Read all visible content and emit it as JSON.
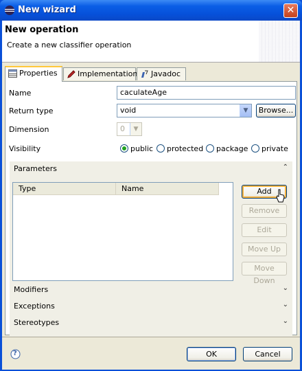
{
  "window": {
    "title": "New wizard"
  },
  "header": {
    "title": "New operation",
    "description": "Create a new classifier operation"
  },
  "tabs": [
    {
      "label": "Properties",
      "icon": "table-icon",
      "active": true
    },
    {
      "label": "Implementation",
      "icon": "pen-icon",
      "active": false
    },
    {
      "label": "Javadoc",
      "icon": "javadoc-icon",
      "active": false
    }
  ],
  "form": {
    "name_label": "Name",
    "name_value": "caculateAge",
    "return_type_label": "Return type",
    "return_type_value": "void",
    "browse_label": "Browse...",
    "dimension_label": "Dimension",
    "dimension_value": "0",
    "visibility_label": "Visibility",
    "visibility_options": [
      "public",
      "protected",
      "package",
      "private"
    ],
    "visibility_selected": "public"
  },
  "parameters": {
    "title": "Parameters",
    "columns": [
      "Type",
      "Name"
    ],
    "rows": [],
    "buttons": {
      "add": "Add",
      "remove": "Remove",
      "edit": "Edit",
      "move_up": "Move Up",
      "move_down": "Move Down"
    }
  },
  "sections": {
    "modifiers": "Modifiers",
    "exceptions": "Exceptions",
    "stereotypes": "Stereotypes"
  },
  "footer": {
    "ok_label": "OK",
    "cancel_label": "Cancel",
    "help_glyph": "?"
  },
  "colors": {
    "titlebar": "#0a5ee6",
    "radio_checked": "#21a121",
    "focus_border": "#f8b33f"
  }
}
